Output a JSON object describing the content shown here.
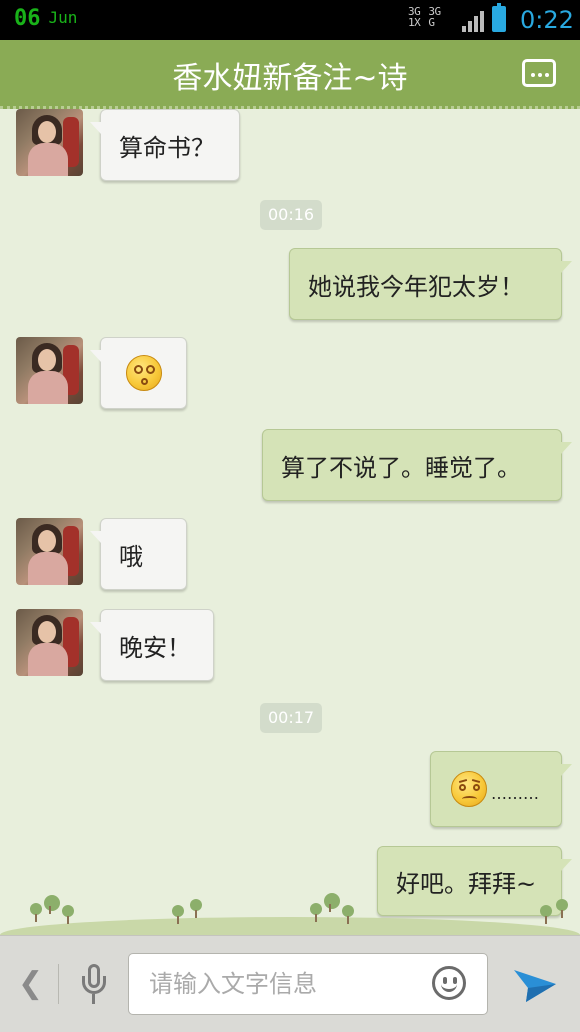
{
  "status_bar": {
    "date_day": "06",
    "date_month": "Jun",
    "network": "3G 3G 1X G",
    "time": "0:22"
  },
  "header": {
    "title": "香水妞新备注~诗",
    "menu_icon": "more-dots-icon"
  },
  "messages": [
    {
      "side": "left",
      "text": "算命书？"
    },
    {
      "type": "timestamp",
      "text": "00:16"
    },
    {
      "side": "right",
      "text": "她说我今年犯太岁！"
    },
    {
      "side": "left",
      "emoji": "dizzy-emoji"
    },
    {
      "side": "right",
      "text": "算了不说了。睡觉了。"
    },
    {
      "side": "left",
      "text": "哦"
    },
    {
      "side": "left",
      "text": "晚安！"
    },
    {
      "type": "timestamp",
      "text": "00:17"
    },
    {
      "side": "right",
      "emoji": "worried-emoji",
      "text": "………"
    },
    {
      "side": "right",
      "text": "好吧。拜拜~"
    }
  ],
  "input_bar": {
    "placeholder": "请输入文字信息",
    "back_icon": "chevron-left-icon",
    "mic_icon": "microphone-icon",
    "emoji_icon": "smiley-icon",
    "send_icon": "send-icon"
  },
  "colors": {
    "header_bg": "#8aab55",
    "chat_bg": "#e8efdc",
    "sent_bubble": "#d5e3b7",
    "received_bubble": "#f5f5f3",
    "accent_blue": "#29a9e0"
  }
}
